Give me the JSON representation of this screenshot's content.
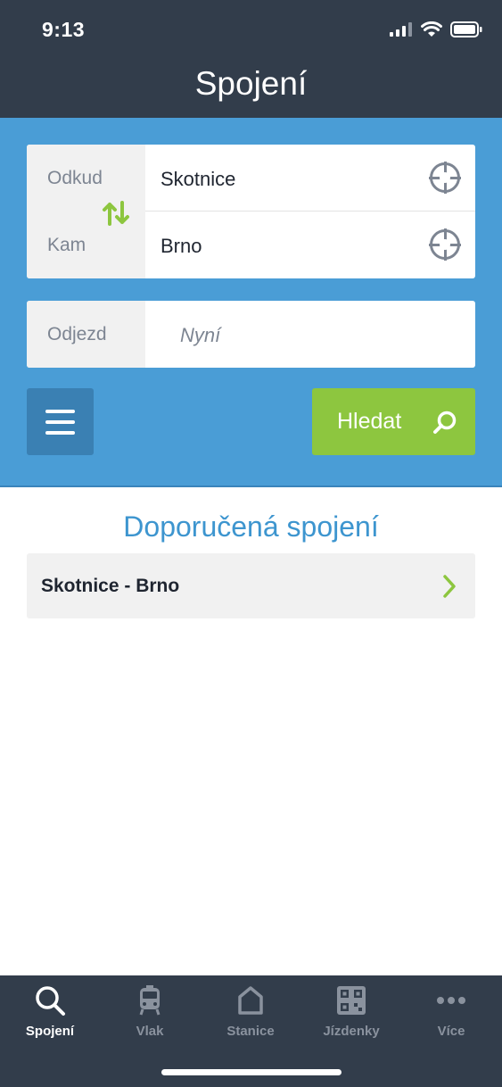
{
  "status": {
    "time": "9:13"
  },
  "header": {
    "title": "Spojení"
  },
  "form": {
    "from_label": "Odkud",
    "from_value": "Skotnice",
    "to_label": "Kam",
    "to_value": "Brno",
    "depart_label": "Odjezd",
    "depart_value": "Nyní",
    "search_label": "Hledat"
  },
  "recommended": {
    "heading": "Doporučená spojení",
    "items": [
      {
        "label": "Skotnice - Brno"
      }
    ]
  },
  "tabs": [
    {
      "label": "Spojení",
      "icon": "search-icon",
      "active": true
    },
    {
      "label": "Vlak",
      "icon": "train-icon",
      "active": false
    },
    {
      "label": "Stanice",
      "icon": "station-icon",
      "active": false
    },
    {
      "label": "Jízdenky",
      "icon": "qr-code-icon",
      "active": false
    },
    {
      "label": "Více",
      "icon": "more-icon",
      "active": false
    }
  ],
  "colors": {
    "header_bg": "#323d4b",
    "panel_bg": "#4a9dd6",
    "accent_green": "#8dc63f",
    "heading_blue": "#3d95cf"
  }
}
